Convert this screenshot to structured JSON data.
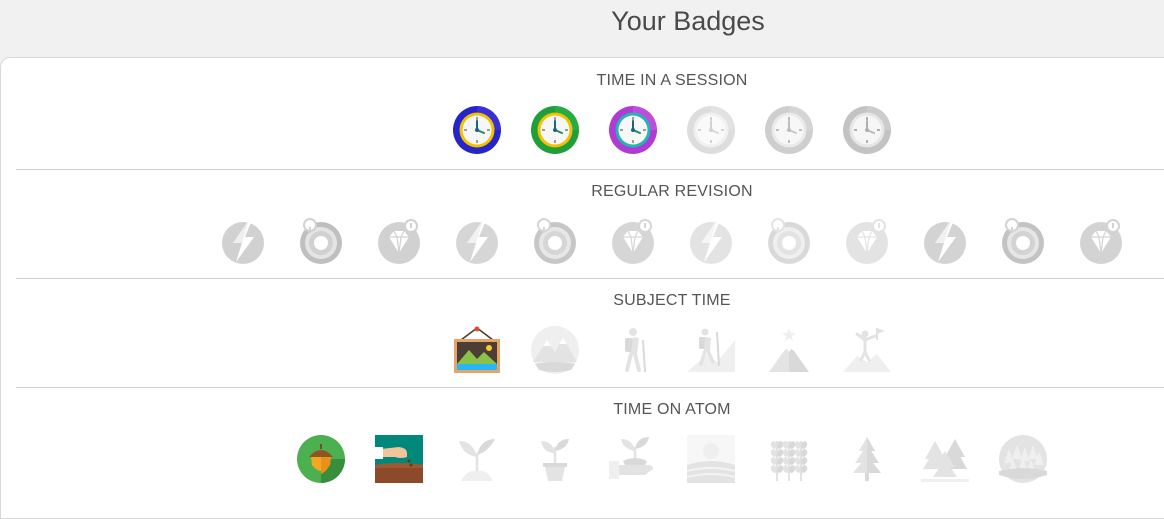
{
  "page": {
    "title": "Your Badges"
  },
  "sections": [
    {
      "title": "TIME IN A SESSION",
      "badges": [
        {
          "icon": "clock-icon",
          "earned": true,
          "ring": "#2525c8",
          "ring2": "#4a3be6",
          "face": "#f7f7f7",
          "rim": "#f2c200"
        },
        {
          "icon": "clock-icon",
          "earned": true,
          "ring": "#1f9e3a",
          "ring2": "#2bb84a",
          "face": "#f7f7f7",
          "rim": "#f2c200"
        },
        {
          "icon": "clock-icon",
          "earned": true,
          "ring": "#b03bd4",
          "ring2": "#c85de6",
          "face": "#f7f7f7",
          "rim": "#23b6b0"
        },
        {
          "icon": "clock-icon",
          "earned": false,
          "opacity": 0.45
        },
        {
          "icon": "clock-icon",
          "earned": false,
          "opacity": 0.65
        },
        {
          "icon": "clock-icon",
          "earned": false,
          "opacity": 0.8
        }
      ]
    },
    {
      "title": "REGULAR REVISION",
      "badges": [
        {
          "icon": "lightning-icon",
          "earned": false,
          "opacity": 0.85
        },
        {
          "icon": "target-icon",
          "earned": false,
          "opacity": 0.85
        },
        {
          "icon": "diamond-icon",
          "earned": false,
          "opacity": 0.85
        },
        {
          "icon": "lightning-icon",
          "earned": false,
          "opacity": 0.75
        },
        {
          "icon": "target-icon",
          "earned": false,
          "opacity": 0.75
        },
        {
          "icon": "diamond-icon",
          "earned": false,
          "opacity": 0.75
        },
        {
          "icon": "lightning-icon",
          "earned": false,
          "opacity": 0.5
        },
        {
          "icon": "target-icon",
          "earned": false,
          "opacity": 0.5
        },
        {
          "icon": "diamond-icon",
          "earned": false,
          "opacity": 0.5
        },
        {
          "icon": "lightning-icon",
          "earned": false,
          "opacity": 0.8
        },
        {
          "icon": "target-icon",
          "earned": false,
          "opacity": 0.8
        },
        {
          "icon": "diamond-icon",
          "earned": false,
          "opacity": 0.8
        }
      ]
    },
    {
      "title": "SUBJECT TIME",
      "badges": [
        {
          "icon": "landscape-picture-icon",
          "earned": true
        },
        {
          "icon": "mountains-icon",
          "earned": false,
          "opacity": 0.5
        },
        {
          "icon": "hiker-icon",
          "earned": false,
          "opacity": 0.5
        },
        {
          "icon": "climber-icon",
          "earned": false,
          "opacity": 0.5
        },
        {
          "icon": "mountain-peak-icon",
          "earned": false,
          "opacity": 0.5
        },
        {
          "icon": "summit-flag-icon",
          "earned": false,
          "opacity": 0.5
        }
      ]
    },
    {
      "title": "TIME ON ATOM",
      "badges": [
        {
          "icon": "acorn-icon",
          "earned": true
        },
        {
          "icon": "seed-planting-icon",
          "earned": true
        },
        {
          "icon": "sprout-icon",
          "earned": false,
          "opacity": 0.5
        },
        {
          "icon": "potted-plant-icon",
          "earned": false,
          "opacity": 0.5
        },
        {
          "icon": "hand-plant-icon",
          "earned": false,
          "opacity": 0.5
        },
        {
          "icon": "field-sun-icon",
          "earned": false,
          "opacity": 0.5
        },
        {
          "icon": "wheat-icon",
          "earned": false,
          "opacity": 0.5
        },
        {
          "icon": "tree-icon",
          "earned": false,
          "opacity": 0.5
        },
        {
          "icon": "forest-icon",
          "earned": false,
          "opacity": 0.5
        },
        {
          "icon": "woodland-icon",
          "earned": false,
          "opacity": 0.5
        }
      ]
    }
  ]
}
